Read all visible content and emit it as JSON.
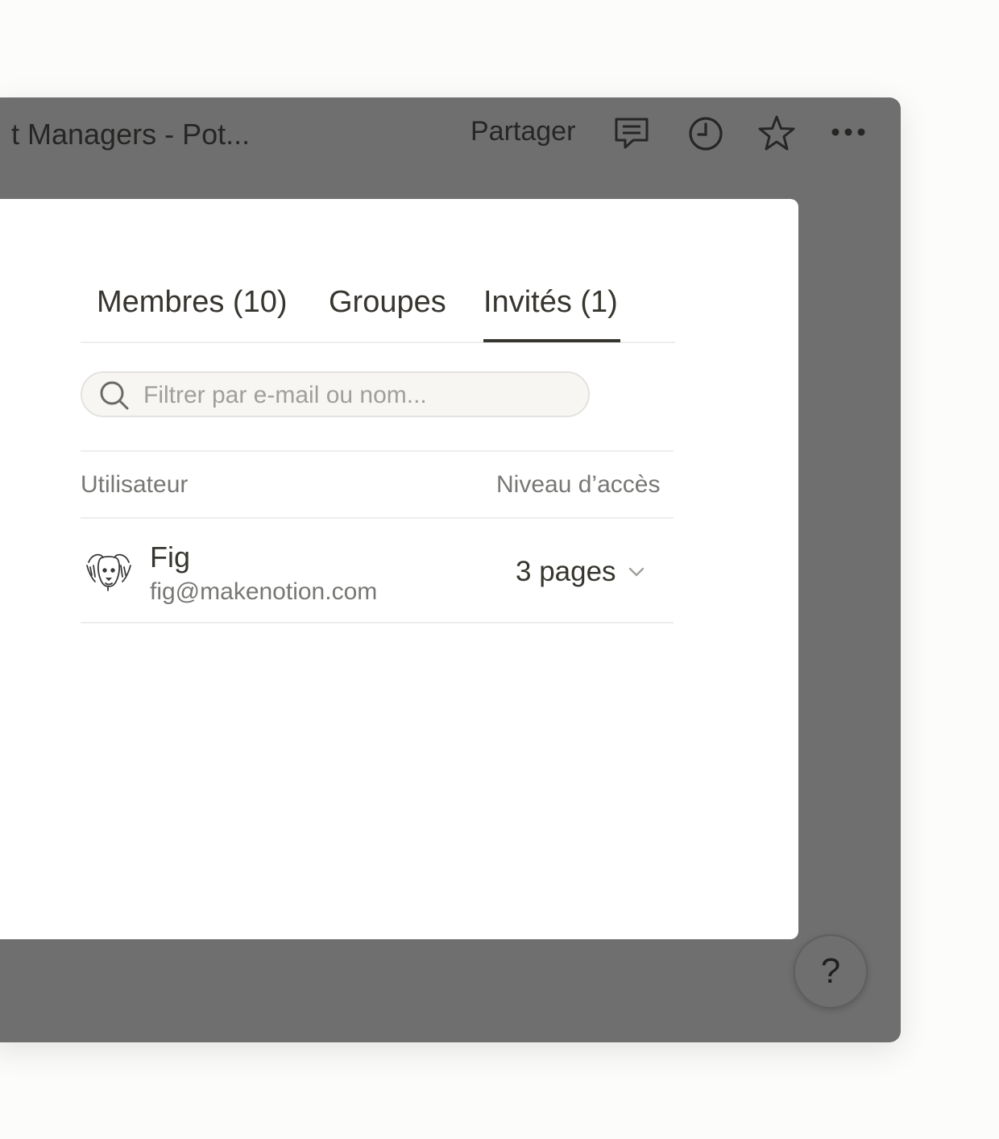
{
  "topbar": {
    "title": "t Managers - Pot...",
    "share_label": "Partager",
    "icons": [
      "comment-icon",
      "clock-icon",
      "star-icon",
      "more-icon"
    ]
  },
  "tabs": [
    {
      "label": "Membres (10)",
      "active": false
    },
    {
      "label": "Groupes",
      "active": false
    },
    {
      "label": "Invités (1)",
      "active": true
    }
  ],
  "search": {
    "placeholder": "Filtrer par e-mail ou nom...",
    "value": ""
  },
  "table": {
    "headers": {
      "user": "Utilisateur",
      "access": "Niveau d’accès"
    },
    "rows": [
      {
        "name": "Fig",
        "email": "fig@makenotion.com",
        "access": "3 pages"
      }
    ]
  },
  "help": {
    "label": "?"
  },
  "colors": {
    "overlay": "#6f6f6f",
    "text": "#37352f",
    "muted": "#787774",
    "divider": "#ededec",
    "search_bg": "#f7f6f3"
  }
}
